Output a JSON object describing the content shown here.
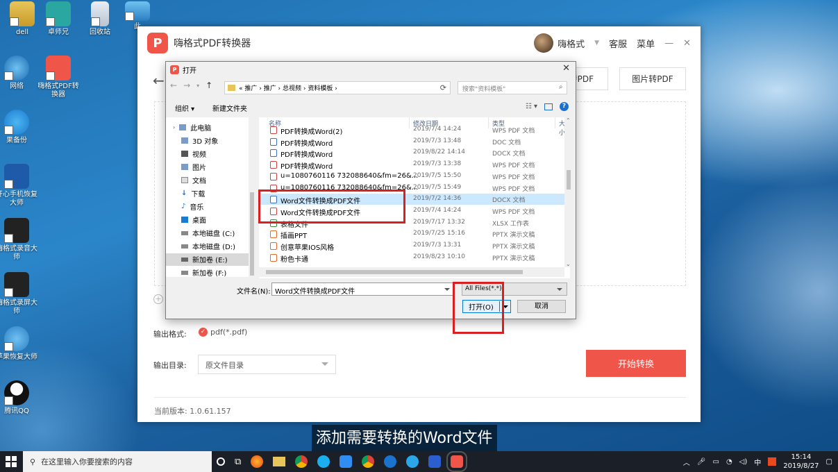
{
  "desktop": {
    "icons": [
      {
        "label": "dell"
      },
      {
        "label": "卓师兄"
      },
      {
        "label": "回收站"
      },
      {
        "label": "此"
      },
      {
        "label": "网络"
      },
      {
        "label": "嗨格式PDF转换器"
      },
      {
        "label": "果备份"
      },
      {
        "label": "开心手机恢复大师"
      },
      {
        "label": "嗨格式录音大师"
      },
      {
        "label": "嗨格式录屏大师"
      },
      {
        "label": "苹果恢复大师"
      },
      {
        "label": "腾讯QQ"
      }
    ]
  },
  "app": {
    "title": "嗨格式PDF转换器",
    "logo_glyph": "P",
    "user_name": "嗨格式",
    "service": "客服",
    "menu": "菜单",
    "minimize": "—",
    "close": "✕",
    "back": "←",
    "tab_word_pdf": "转PDF",
    "tab_image_pdf": "图片转PDF",
    "output_format_label": "输出格式:",
    "output_format_value": "pdf(*.pdf)",
    "output_dir_label": "输出目录:",
    "output_dir_value": "原文件目录",
    "start_button": "开始转换",
    "version": "当前版本: 1.0.61.157",
    "accent_color": "#f0554a"
  },
  "dialog": {
    "title": "打开",
    "breadcrumb": "« 推广 › 推广 › 总视频 › 资料模板 ›",
    "search_placeholder": "搜索\"资料模板\"",
    "organize": "组织 ▾",
    "new_folder": "新建文件夹",
    "tree": [
      "此电脑",
      "3D 对象",
      "视频",
      "图片",
      "文档",
      "下载",
      "音乐",
      "桌面",
      "本地磁盘 (C:)",
      "本地磁盘 (D:)",
      "新加卷 (E:)",
      "新加卷 (F:)"
    ],
    "columns": {
      "name": "名称",
      "date": "修改日期",
      "type": "类型",
      "size": "大小"
    },
    "files": [
      {
        "name": "PDF转换成Word(2)",
        "date": "2019/7/4 14:24",
        "type": "WPS PDF 文档",
        "kind": "pdf"
      },
      {
        "name": "PDF转换成Word",
        "date": "2019/7/3 13:48",
        "type": "DOC 文档",
        "kind": "doc"
      },
      {
        "name": "PDF转换成Word",
        "date": "2019/8/22 14:14",
        "type": "DOCX 文档",
        "kind": "doc"
      },
      {
        "name": "PDF转换成Word",
        "date": "2019/7/3 13:38",
        "type": "WPS PDF 文档",
        "kind": "pdf"
      },
      {
        "name": "u=1080760116 732088640&fm=26&...",
        "date": "2019/7/5 15:50",
        "type": "WPS PDF 文档",
        "kind": "pdf"
      },
      {
        "name": "u=1080760116 732088640&fm=26&...",
        "date": "2019/7/5 15:49",
        "type": "WPS PDF 文档",
        "kind": "pdf"
      },
      {
        "name": "Word文件转换成PDF文件",
        "date": "2019/7/2 14:36",
        "type": "DOCX 文档",
        "kind": "doc"
      },
      {
        "name": "Word文件转换成PDF文件",
        "date": "2019/7/4 14:24",
        "type": "WPS PDF 文档",
        "kind": "pdf"
      },
      {
        "name": "表格文件",
        "date": "2019/7/17 13:32",
        "type": "XLSX 工作表",
        "kind": "xls"
      },
      {
        "name": "插画PPT",
        "date": "2019/7/25 15:16",
        "type": "PPTX 演示文稿",
        "kind": "ppt"
      },
      {
        "name": "创意苹果IOS风格",
        "date": "2019/7/3 13:31",
        "type": "PPTX 演示文稿",
        "kind": "ppt"
      },
      {
        "name": "粉色卡通",
        "date": "2019/8/23 10:10",
        "type": "PPTX 演示文稿",
        "kind": "ppt"
      }
    ],
    "selected_index": 6,
    "filename_label": "文件名(N):",
    "filename_value": "Word文件转换成PDF文件",
    "filetype_value": "All Files(*.*)",
    "open_button": "打开(O)",
    "cancel_button": "取消"
  },
  "subtitle": "添加需要转换的Word文件",
  "taskbar": {
    "search_placeholder": "在这里输入你要搜索的内容",
    "time": "15:14",
    "date": "2019/8/27",
    "ime": "中"
  }
}
